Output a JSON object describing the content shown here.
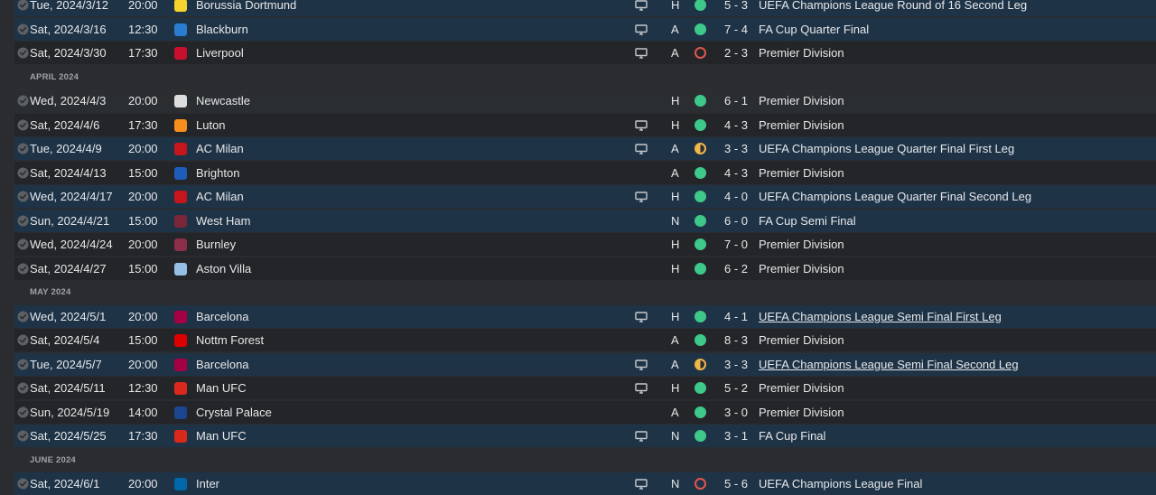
{
  "fixtures": [
    {
      "kind": "match",
      "style": "blue",
      "date": "Tue, 2024/3/12",
      "time": "20:00",
      "team": "Borussia Dortmund",
      "crest": "#f6d32d",
      "tv": true,
      "venue": "H",
      "result": "win",
      "score": "5 - 3",
      "competition": "UEFA Champions League Round of 16 Second Leg",
      "link": false
    },
    {
      "kind": "match",
      "style": "blue",
      "date": "Sat, 2024/3/16",
      "time": "12:30",
      "team": "Blackburn",
      "crest": "#2b7bd1",
      "tv": true,
      "venue": "A",
      "result": "win",
      "score": "7 - 4",
      "competition": "FA Cup Quarter Final",
      "link": false
    },
    {
      "kind": "match",
      "style": "dark",
      "date": "Sat, 2024/3/30",
      "time": "17:30",
      "team": "Liverpool",
      "crest": "#c8102e",
      "tv": true,
      "venue": "A",
      "result": "loss",
      "score": "2 - 3",
      "competition": "Premier Division",
      "link": false
    },
    {
      "kind": "month",
      "label": "APRIL 2024"
    },
    {
      "kind": "match",
      "style": "light",
      "date": "Wed, 2024/4/3",
      "time": "20:00",
      "team": "Newcastle",
      "crest": "#dddddd",
      "tv": false,
      "venue": "H",
      "result": "win",
      "score": "6 - 1",
      "competition": "Premier Division",
      "link": false
    },
    {
      "kind": "match",
      "style": "dark",
      "date": "Sat, 2024/4/6",
      "time": "17:30",
      "team": "Luton",
      "crest": "#f78f1e",
      "tv": true,
      "venue": "H",
      "result": "win",
      "score": "4 - 3",
      "competition": "Premier Division",
      "link": false
    },
    {
      "kind": "match",
      "style": "blue",
      "date": "Tue, 2024/4/9",
      "time": "20:00",
      "team": "AC Milan",
      "crest": "#c4161c",
      "tv": true,
      "venue": "A",
      "result": "draw",
      "score": "3 - 3",
      "competition": "UEFA Champions League Quarter Final First Leg",
      "link": false
    },
    {
      "kind": "match",
      "style": "dark",
      "date": "Sat, 2024/4/13",
      "time": "15:00",
      "team": "Brighton",
      "crest": "#1d5db9",
      "tv": false,
      "venue": "A",
      "result": "win",
      "score": "4 - 3",
      "competition": "Premier Division",
      "link": false
    },
    {
      "kind": "match",
      "style": "blue",
      "date": "Wed, 2024/4/17",
      "time": "20:00",
      "team": "AC Milan",
      "crest": "#c4161c",
      "tv": true,
      "venue": "H",
      "result": "win",
      "score": "4 - 0",
      "competition": "UEFA Champions League Quarter Final Second Leg",
      "link": false
    },
    {
      "kind": "match",
      "style": "blue",
      "date": "Sun, 2024/4/21",
      "time": "15:00",
      "team": "West Ham",
      "crest": "#7a263a",
      "tv": false,
      "venue": "N",
      "result": "win",
      "score": "6 - 0",
      "competition": "FA Cup Semi Final",
      "link": false
    },
    {
      "kind": "match",
      "style": "dark",
      "date": "Wed, 2024/4/24",
      "time": "20:00",
      "team": "Burnley",
      "crest": "#8c2f4b",
      "tv": false,
      "venue": "H",
      "result": "win",
      "score": "7 - 0",
      "competition": "Premier Division",
      "link": false
    },
    {
      "kind": "match",
      "style": "dark",
      "date": "Sat, 2024/4/27",
      "time": "15:00",
      "team": "Aston Villa",
      "crest": "#95bfe5",
      "tv": false,
      "venue": "H",
      "result": "win",
      "score": "6 - 2",
      "competition": "Premier Division",
      "link": false
    },
    {
      "kind": "month",
      "label": "MAY 2024"
    },
    {
      "kind": "match",
      "style": "blue",
      "date": "Wed, 2024/5/1",
      "time": "20:00",
      "team": "Barcelona",
      "crest": "#a50044",
      "tv": true,
      "venue": "H",
      "result": "win",
      "score": "4 - 1",
      "competition": "UEFA Champions League Semi Final First Leg",
      "link": true
    },
    {
      "kind": "match",
      "style": "dark",
      "date": "Sat, 2024/5/4",
      "time": "15:00",
      "team": "Nottm Forest",
      "crest": "#dd0000",
      "tv": false,
      "venue": "A",
      "result": "win",
      "score": "8 - 3",
      "competition": "Premier Division",
      "link": false
    },
    {
      "kind": "match",
      "style": "blue",
      "date": "Tue, 2024/5/7",
      "time": "20:00",
      "team": "Barcelona",
      "crest": "#a50044",
      "tv": true,
      "venue": "A",
      "result": "draw",
      "score": "3 - 3",
      "competition": "UEFA Champions League Semi Final Second Leg",
      "link": true
    },
    {
      "kind": "match",
      "style": "dark",
      "date": "Sat, 2024/5/11",
      "time": "12:30",
      "team": "Man UFC",
      "crest": "#da291c",
      "tv": true,
      "venue": "H",
      "result": "win",
      "score": "5 - 2",
      "competition": "Premier Division",
      "link": false
    },
    {
      "kind": "match",
      "style": "dark",
      "date": "Sun, 2024/5/19",
      "time": "14:00",
      "team": "Crystal Palace",
      "crest": "#1b458f",
      "tv": false,
      "venue": "A",
      "result": "win",
      "score": "3 - 0",
      "competition": "Premier Division",
      "link": false
    },
    {
      "kind": "match",
      "style": "blue",
      "date": "Sat, 2024/5/25",
      "time": "17:30",
      "team": "Man UFC",
      "crest": "#da291c",
      "tv": true,
      "venue": "N",
      "result": "win",
      "score": "3 - 1",
      "competition": "FA Cup Final",
      "link": false
    },
    {
      "kind": "month",
      "label": "JUNE 2024"
    },
    {
      "kind": "match",
      "style": "blue",
      "date": "Sat, 2024/6/1",
      "time": "20:00",
      "team": "Inter",
      "crest": "#0068a8",
      "tv": true,
      "venue": "N",
      "result": "loss",
      "score": "5 - 6",
      "competition": "UEFA Champions League Final",
      "link": false
    }
  ]
}
